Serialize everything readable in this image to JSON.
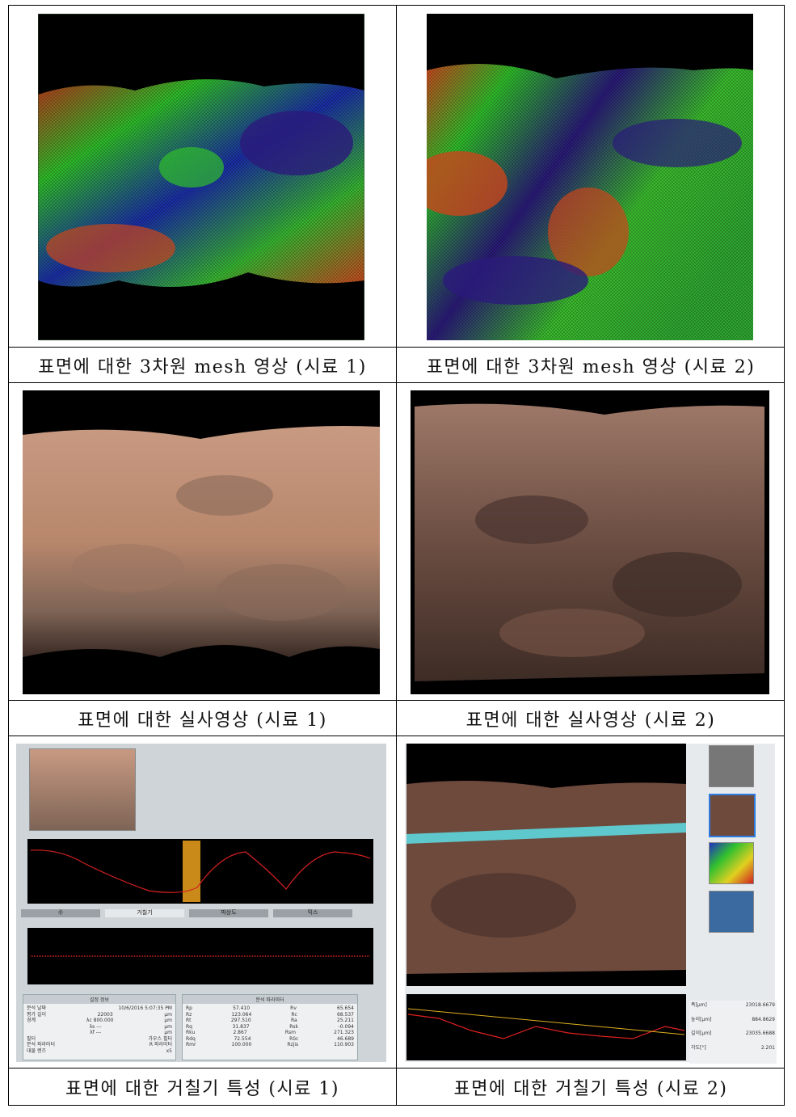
{
  "captions": {
    "mesh_1": "표면에 대한 3차원 mesh 영상 (시료 1)",
    "mesh_2": "표면에 대한 3차원 mesh 영상 (시료 2)",
    "real_1": "표면에 대한 실사영상 (시료 1)",
    "real_2": "표면에 대한 실사영상 (시료 2)",
    "rough_1": "표면에 대한 거칠기 특성 (시료 1)",
    "rough_2": "표면에 대한 거칠기 특성 (시료 2)"
  },
  "roughness_1": {
    "tabs": [
      "수",
      "거칠기",
      "파상도",
      "믹스"
    ],
    "settings_title": "설정 정보",
    "settings": [
      [
        "분석 날짜",
        "10/6/2016 5:07:35 PM"
      ],
      [
        "평가 길이",
        "22003",
        "μm"
      ],
      [
        "경계",
        "λc  800.000",
        "μm"
      ],
      [
        "",
        "λs  ---",
        "μm"
      ],
      [
        "",
        "λf  ---",
        "μm"
      ],
      [
        "필터",
        "가우스 필터"
      ],
      [
        "분석 파라미터",
        "R 파라미터"
      ],
      [
        "대물 렌즈",
        "x5"
      ]
    ],
    "params_title": "분석 파라미터",
    "params": [
      [
        "Rp",
        "57.410",
        "Rv",
        "65.654"
      ],
      [
        "Rz",
        "123.064",
        "Rc",
        "68.537"
      ],
      [
        "Rt",
        "297.510",
        "Ra",
        "25.211"
      ],
      [
        "Rq",
        "31.837",
        "Rsk",
        "-0.094"
      ],
      [
        "Rku",
        "2.867",
        "Rsm",
        "271.323"
      ],
      [
        "Rdq",
        "72.554",
        "Rδc",
        "46.689"
      ],
      [
        "Rmr",
        "100.000",
        "Rzjis",
        "110.903"
      ]
    ]
  },
  "roughness_2": {
    "side_labels": [
      "폭[μm]",
      "높이[μm]",
      "길이[μm]",
      "각도[°]"
    ],
    "side_values": [
      "23018.6679",
      "884.8629",
      "23035.6688",
      "2.201"
    ]
  }
}
